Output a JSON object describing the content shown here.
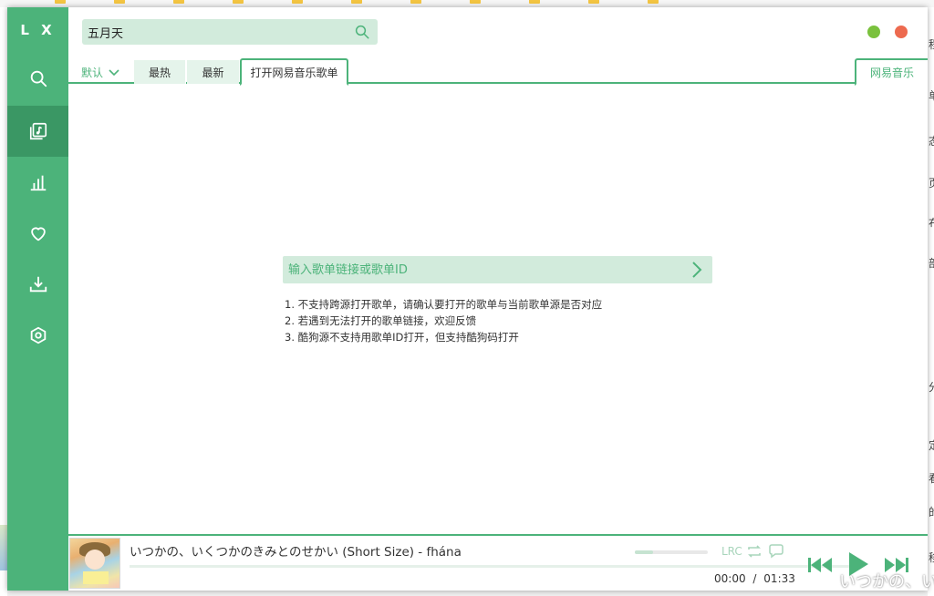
{
  "app": {
    "logo": "L X",
    "colors": {
      "accent": "#4cb37a",
      "accent_dark": "#3a9764",
      "accent_light": "#d2ebdc",
      "min_button": "#7ac13d",
      "close_button": "#ed6a4f"
    }
  },
  "sidebar": {
    "items": [
      {
        "name": "search",
        "icon": "search-icon",
        "active": false
      },
      {
        "name": "songlist",
        "icon": "music-list-icon",
        "active": true
      },
      {
        "name": "leaderboard",
        "icon": "bar-chart-icon",
        "active": false
      },
      {
        "name": "favorites",
        "icon": "heart-icon",
        "active": false
      },
      {
        "name": "download",
        "icon": "download-icon",
        "active": false
      },
      {
        "name": "settings",
        "icon": "hexagon-settings-icon",
        "active": false
      }
    ]
  },
  "search": {
    "value": "五月天"
  },
  "tabs": {
    "sort_default": "默认",
    "hot": "最热",
    "new": "最新",
    "open_songlist": "打开网易音乐歌单",
    "source": "网易音乐"
  },
  "open_songlist": {
    "placeholder": "输入歌单链接或歌单ID",
    "tips": [
      "1. 不支持跨源打开歌单，请确认要打开的歌单与当前歌单源是否对应",
      "2. 若遇到无法打开的歌单链接，欢迎反馈",
      "3. 酷狗源不支持用歌单ID打开，但支持酷狗码打开"
    ]
  },
  "player": {
    "title": "いつかの、いくつかのきみとのせかい (Short Size) - fhána",
    "lrc_label": "LRC",
    "current_time": "00:00",
    "separator": "/",
    "total_time": "01:33",
    "volume": 0.25,
    "progress": 0
  },
  "background": {
    "right_edge_chars": [
      "程",
      "单",
      "态",
      "页",
      "布",
      "部",
      "分",
      "定",
      "看",
      "的",
      "移"
    ],
    "overlay_text": "いつかの、い"
  }
}
